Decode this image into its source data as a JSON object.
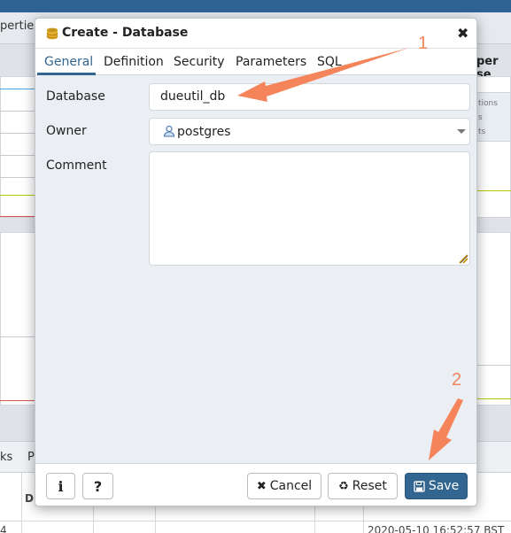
{
  "background": {
    "tab_left": "perties",
    "tab_right": "per se",
    "side_items": [
      "tions",
      "s",
      "ts"
    ],
    "bottom_tabs": [
      "ks",
      "P"
    ],
    "table_header": "D",
    "row_left": "4",
    "row_timestamp": "2020-05-10 16:52:57 BST"
  },
  "dialog": {
    "title": "Create - Database",
    "close_label": "✖",
    "tabs": [
      {
        "label": "General"
      },
      {
        "label": "Definition"
      },
      {
        "label": "Security"
      },
      {
        "label": "Parameters"
      },
      {
        "label": "SQL"
      }
    ],
    "fields": {
      "database_label": "Database",
      "database_value": "dueutil_db",
      "owner_label": "Owner",
      "owner_value": "postgres",
      "comment_label": "Comment",
      "comment_value": ""
    },
    "footer": {
      "info_label": "i",
      "help_label": "?",
      "cancel_label": "Cancel",
      "reset_label": "Reset",
      "save_label": "Save"
    }
  },
  "annotations": {
    "step1": "1",
    "step2": "2"
  },
  "colors": {
    "accent": "#326690",
    "annotation": "#f5845a"
  }
}
